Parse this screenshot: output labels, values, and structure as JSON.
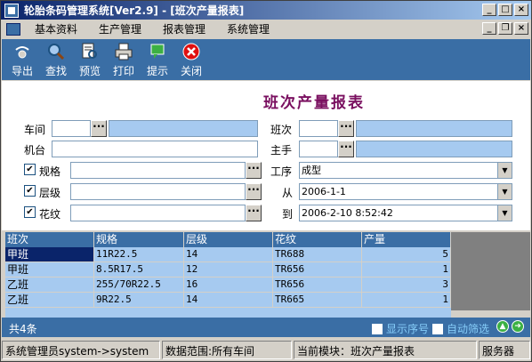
{
  "window": {
    "title": "轮胎条码管理系统[Ver2.9] - [班次产量报表]"
  },
  "menu": [
    "基本资料",
    "生产管理",
    "报表管理",
    "系统管理"
  ],
  "toolbar": [
    {
      "label": "导出",
      "icon": "export-icon"
    },
    {
      "label": "查找",
      "icon": "search-icon"
    },
    {
      "label": "预览",
      "icon": "preview-icon"
    },
    {
      "label": "打印",
      "icon": "print-icon"
    },
    {
      "label": "提示",
      "icon": "hint-icon"
    },
    {
      "label": "关闭",
      "icon": "close-icon"
    }
  ],
  "report_title": "班次产量报表",
  "form": {
    "workshop_label": "车间",
    "machine_label": "机台",
    "spec_label": "规格",
    "level_label": "层级",
    "pattern_label": "花纹",
    "shift_label": "班次",
    "operator_label": "主手",
    "process_label": "工序",
    "process_value": "成型",
    "from_label": "从",
    "from_value": "2006-1-1",
    "to_label": "到",
    "to_value": "2006-2-10 8:52:42",
    "dots": "···"
  },
  "table": {
    "headers": [
      "班次",
      "规格",
      "层级",
      "花纹",
      "产量"
    ],
    "rows": [
      [
        "甲班",
        "11R22.5",
        "14",
        "TR688",
        "5"
      ],
      [
        "甲班",
        "8.5R17.5",
        "12",
        "TR656",
        "1"
      ],
      [
        "乙班",
        "255/70R22.5",
        "16",
        "TR656",
        "3"
      ],
      [
        "乙班",
        "9R22.5",
        "14",
        "TR665",
        "1"
      ]
    ]
  },
  "footer": {
    "count": "共4条",
    "show_seq": "显示序号",
    "auto_filter": "自动筛选"
  },
  "status": [
    "系统管理员system->system",
    "数据范围:所有车间",
    "当前模块：班次产量报表",
    "服务器"
  ],
  "colors": {
    "accent": "#3a6ea5",
    "titlebar": "#0a246a",
    "highlight": "#a6caf0",
    "report_title": "#7a1060"
  }
}
